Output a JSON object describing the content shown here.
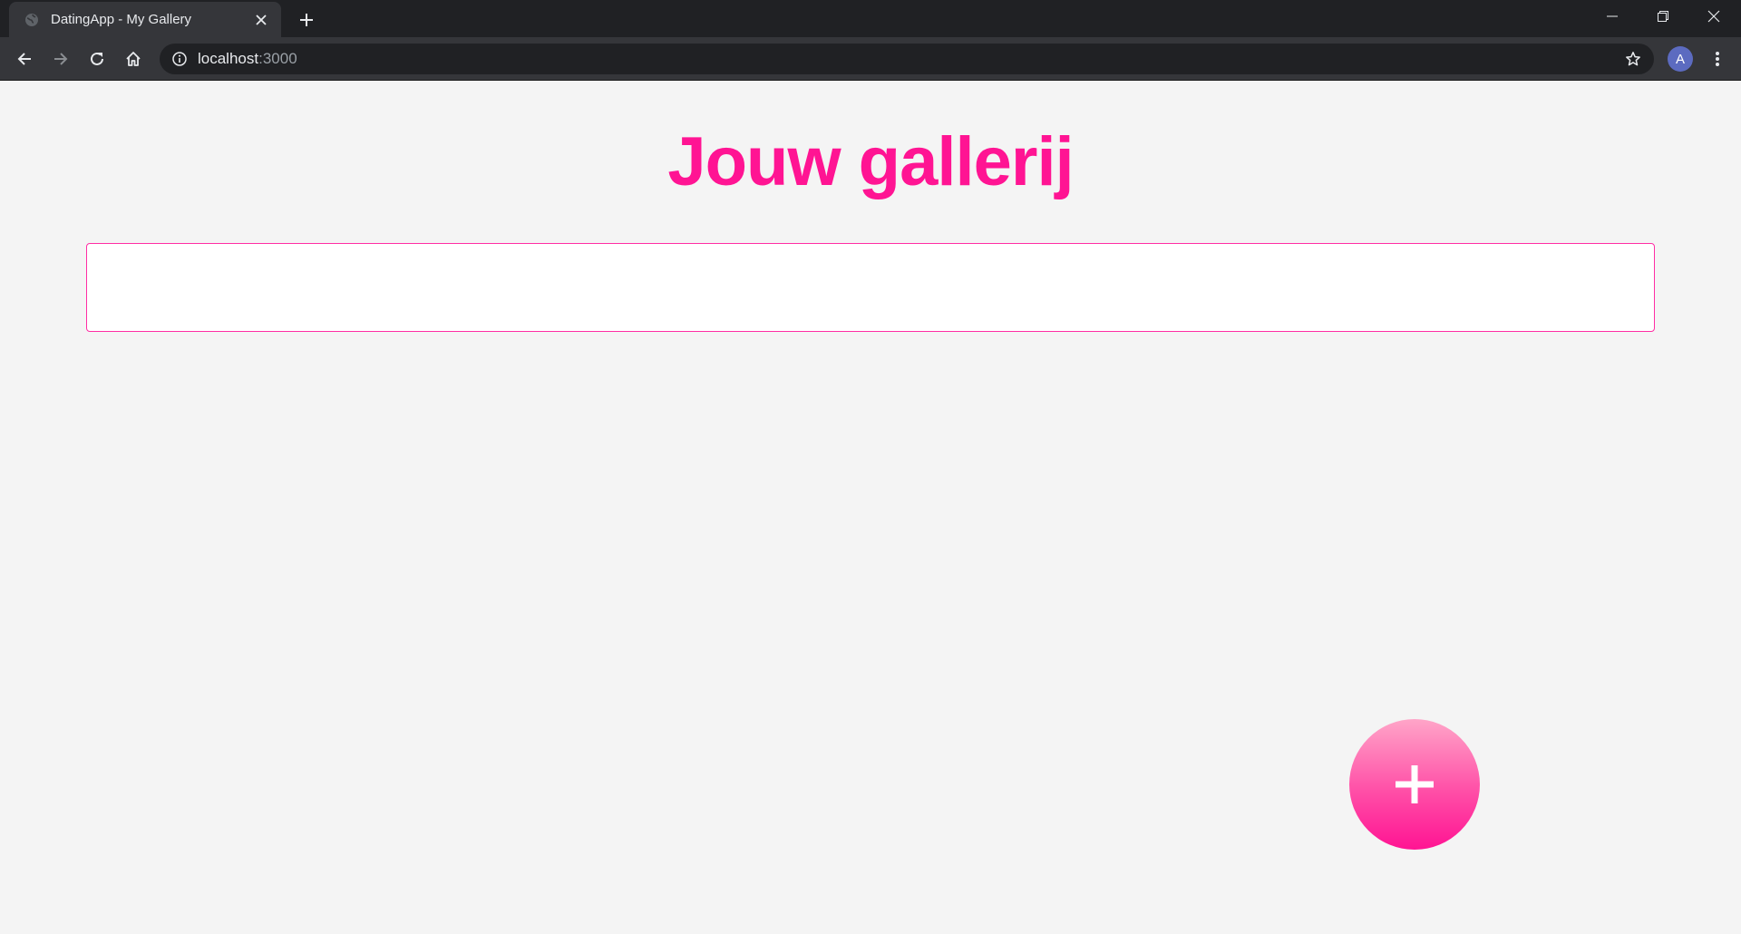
{
  "browser": {
    "tab": {
      "title": "DatingApp - My Gallery"
    },
    "address": {
      "host": "localhost",
      "port": ":3000"
    },
    "profile_initial": "A"
  },
  "page": {
    "title": "Jouw gallerij",
    "accent_color": "#ff1493",
    "background_color": "#f4f4f4"
  },
  "icons": {
    "favicon": "globe-icon",
    "tab_close": "close-icon",
    "new_tab": "plus-icon",
    "back": "arrow-left-icon",
    "forward": "arrow-right-icon",
    "reload": "reload-icon",
    "home": "home-icon",
    "site_info": "info-icon",
    "bookmark": "star-icon",
    "menu": "kebab-menu-icon",
    "add_photo": "plus-icon"
  }
}
